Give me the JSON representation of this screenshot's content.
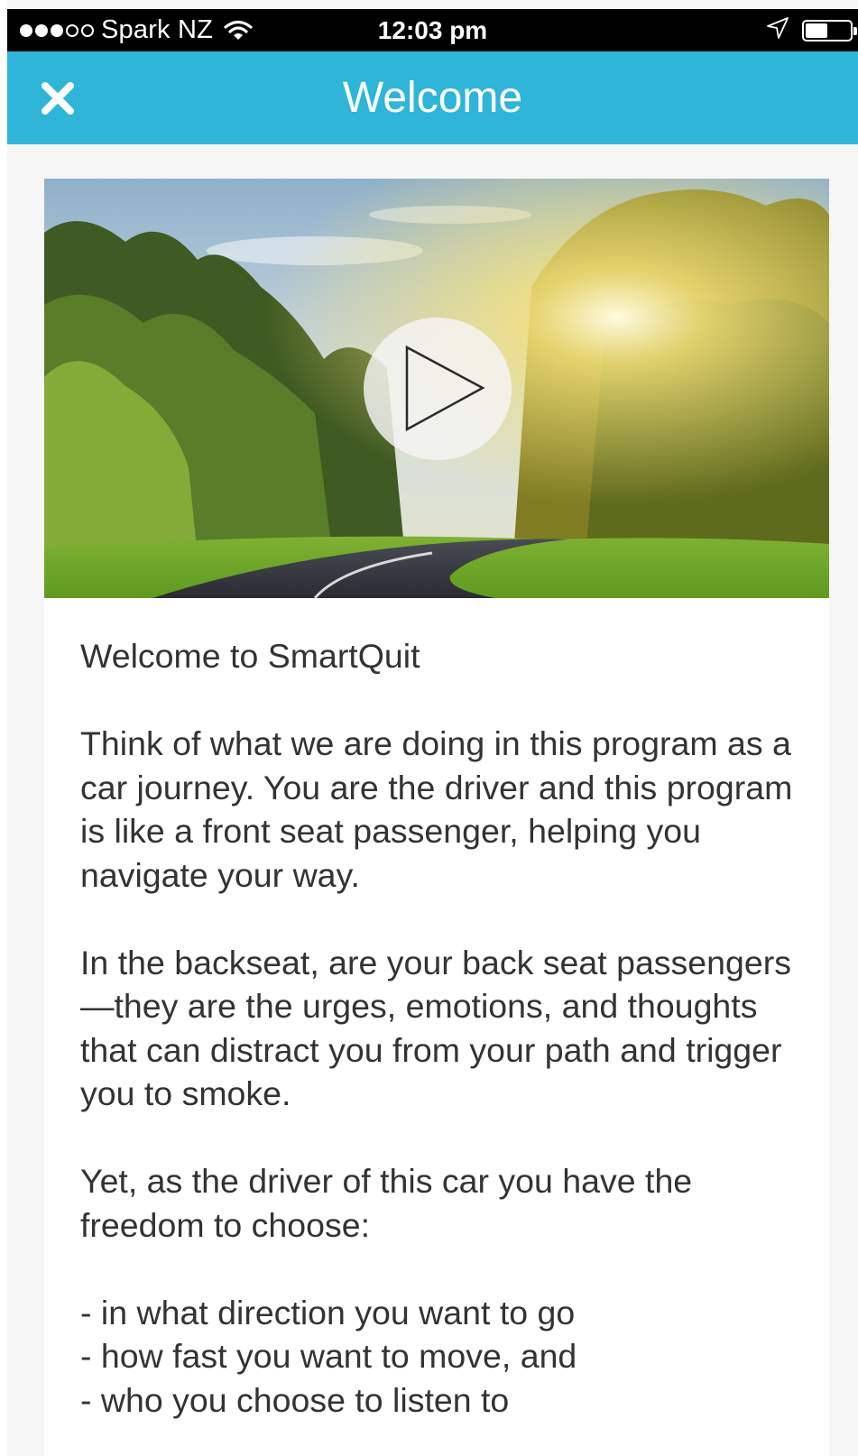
{
  "status_bar": {
    "carrier": "Spark NZ",
    "signal_filled": 3,
    "signal_total": 5,
    "time": "12:03 pm",
    "battery_level": 0.5
  },
  "nav": {
    "title": "Welcome",
    "close_icon": "close-icon",
    "background_color": "#2eb5d8"
  },
  "video": {
    "thumbnail": "sunlit road through trees",
    "play_icon": "play-icon"
  },
  "content": {
    "heading": "Welcome to SmartQuit",
    "paragraphs": [
      "Think of what we are doing in this program as a car journey. You are the driver and this program is like a front seat passenger, helping you navigate your way.",
      "In the backseat, are your back seat passengers—they are the urges, emotions, and thoughts that can distract you from your path and trigger you to smoke.",
      "Yet, as the driver of this car you have the freedom to choose:"
    ],
    "choices": [
      "- in what direction you want to go",
      "- how fast you want to move, and",
      "- who you choose to listen to"
    ]
  }
}
